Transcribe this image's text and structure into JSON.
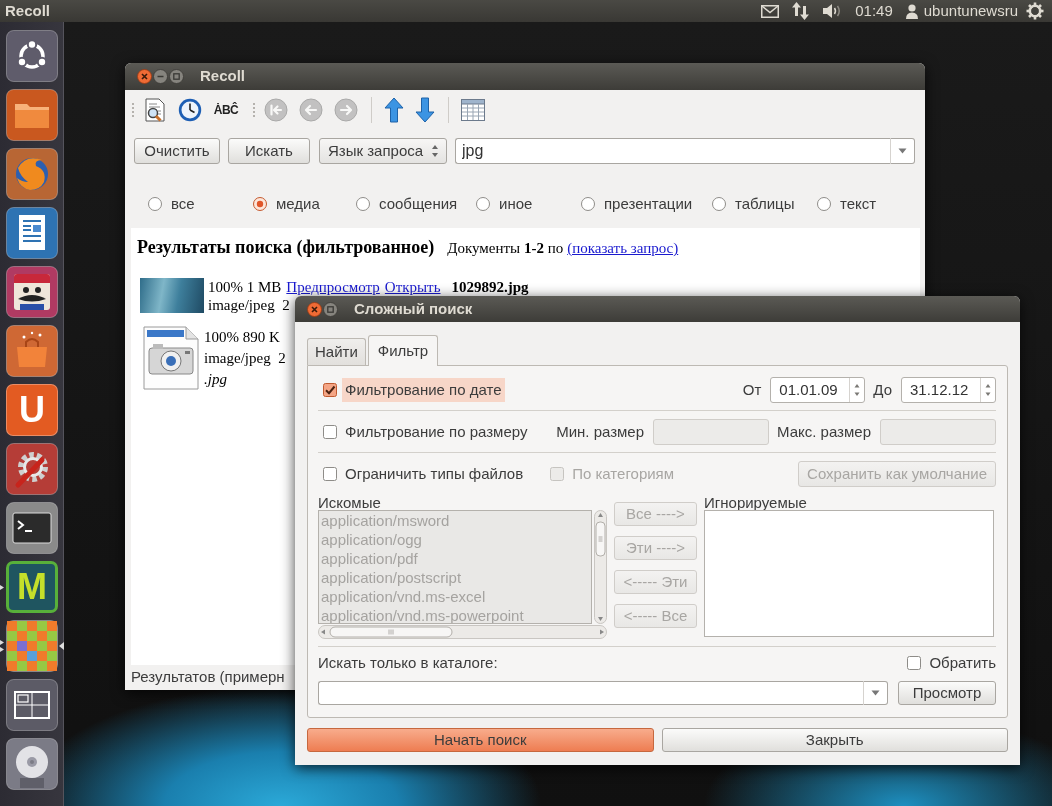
{
  "top_panel": {
    "app_title": "Recoll",
    "clock": "01:49",
    "user": "ubuntunewsru"
  },
  "launcher": [
    {
      "kind": "dash",
      "running": false,
      "multiple_windows": false,
      "focused": false
    },
    {
      "kind": "files",
      "running": false,
      "multiple_windows": false,
      "focused": false
    },
    {
      "kind": "browser",
      "running": false,
      "multiple_windows": false,
      "focused": false
    },
    {
      "kind": "writer",
      "running": false,
      "multiple_windows": false,
      "focused": false
    },
    {
      "kind": "game",
      "running": false,
      "multiple_windows": false,
      "focused": false
    },
    {
      "kind": "store",
      "running": false,
      "multiple_windows": false,
      "focused": false
    },
    {
      "kind": "orange-letter",
      "glyph": "U",
      "running": false,
      "multiple_windows": false,
      "focused": false
    },
    {
      "kind": "settings",
      "running": false,
      "multiple_windows": false,
      "focused": false
    },
    {
      "kind": "terminal",
      "running": false,
      "multiple_windows": false,
      "focused": false
    },
    {
      "kind": "green-letter",
      "glyph": "M",
      "running": true,
      "multiple_windows": false,
      "focused": false
    },
    {
      "kind": "checker",
      "running": true,
      "multiple_windows": true,
      "focused": true
    },
    {
      "kind": "workspaces",
      "running": false,
      "multiple_windows": false,
      "focused": false
    },
    {
      "kind": "disc",
      "running": false,
      "multiple_windows": false,
      "focused": false
    }
  ],
  "recoll_window": {
    "title": "Recoll",
    "toolbars": [
      {
        "groups": [
          [
            {
              "kind": "preview",
              "disabled": false
            },
            {
              "kind": "history",
              "disabled": false
            },
            {
              "kind": "spelling",
              "glyph": "ȦBĈ",
              "disabled": false
            }
          ]
        ]
      },
      {
        "groups": [
          [
            {
              "kind": "first",
              "disabled": true
            },
            {
              "kind": "previous",
              "disabled": true
            },
            {
              "kind": "next",
              "disabled": true
            }
          ],
          [
            {
              "kind": "sort-up",
              "disabled": false
            },
            {
              "kind": "sort-down",
              "disabled": false
            }
          ],
          [
            {
              "kind": "table",
              "disabled": false
            }
          ]
        ]
      }
    ],
    "buttons": [
      "Очистить",
      "Искать"
    ],
    "query_language": "Язык запроса",
    "search": {
      "value": "jpg"
    },
    "categories": [
      {
        "label": "все",
        "selected": false
      },
      {
        "label": "медиа",
        "selected": true
      },
      {
        "label": "сообщения",
        "selected": false
      },
      {
        "label": "иное",
        "selected": false
      },
      {
        "label": "презентации",
        "selected": false
      },
      {
        "label": "таблицы",
        "selected": false
      },
      {
        "label": "текст",
        "selected": false
      }
    ],
    "results": {
      "heading": "Результаты поиска (фильтрованное)",
      "summary": "Документы **1-2** по",
      "query_link": "(показать запрос)",
      "items": [
        {
          "kind": "photo",
          "info": "100% 1 MB",
          "preview_link": "Предпросмотр",
          "open_link": "Открыть",
          "filename": "1029892.jpg",
          "mime": "image/jpeg  2"
        },
        {
          "kind": "file-icon",
          "info": "100% 890 K",
          "mime": "image/jpeg  2",
          "abstract": ".jpg"
        }
      ]
    },
    "status_bar": "Результатов (примерн"
  },
  "advanced_search": {
    "title": "Сложный поиск",
    "tabs": [
      {
        "label": "Найти",
        "selected": false
      },
      {
        "label": "Фильтр",
        "selected": true
      }
    ],
    "date_filter": {
      "label": "Фильтрование по дате",
      "checked": true,
      "focused": true,
      "from_label": "От",
      "from": "01.01.09",
      "to_label": "До",
      "to": "31.12.12"
    },
    "size_filter": {
      "label": "Фильтрование по размеру",
      "checked": false,
      "min_label": "Мин. размер",
      "max_label": "Макс. размер"
    },
    "type_filter": {
      "label": "Ограничить типы файлов",
      "checked": false,
      "by_category": {
        "label": "По категориям",
        "checked": false
      },
      "save_default": "Сохранить как умолчание",
      "searched_label": "Искомые",
      "searched": [
        "application/msword",
        "application/ogg",
        "application/pdf",
        "application/postscript",
        "application/vnd.ms-excel",
        "application/vnd.ms-powerpoint"
      ],
      "move_buttons": [
        "Все ---->",
        "Эти ---->",
        "<----- Эти",
        "<----- Все"
      ],
      "ignored_label": "Игнорируемые"
    },
    "directory": {
      "label": "Искать только в каталоге:",
      "invert": {
        "label": "Обратить",
        "checked": false
      },
      "browse": "Просмотр"
    },
    "buttons": [
      {
        "label": "Начать поиск",
        "default": true
      },
      {
        "label": "Закрыть",
        "default": false
      }
    ]
  }
}
